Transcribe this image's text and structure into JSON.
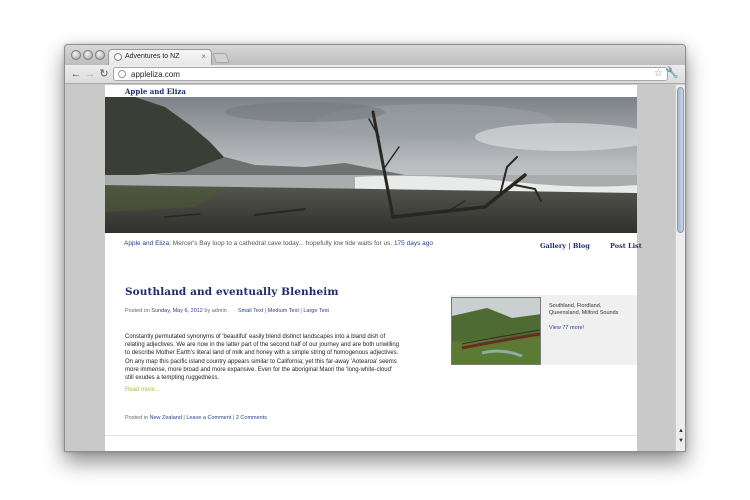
{
  "browser": {
    "tab_title": "Adventures to NZ",
    "url": "appleliza.com"
  },
  "site": {
    "title": "Apple and Eliza",
    "intro_author": "Apple and Eliza:",
    "intro_text": " Mercer's Bay loop to a cathedral cave today... hopefully low tide waits for us. ",
    "intro_time": "175 days ago",
    "nav_gallery": "Gallery | Blog",
    "nav_postlist": "Post List"
  },
  "post": {
    "title": "Southland and eventually Blenheim",
    "posted_on_label": "Posted on ",
    "date": "Sunday, May 6, 2012",
    "by_label": " by ",
    "author": "admin",
    "text_small": "Small Text",
    "text_medium": "Medium Text",
    "text_large": "Large Text",
    "body": "Constantly permutated synonyms of 'beautiful' easily blend distinct landscapes into a bland dish of relating adjectives. We are now in the latter part of the second half of our journey and are both unwilling to describe Mother Earth's literal land of milk and honey with a simple string of homogenous adjectives. On any map this pacific island country appears similar to California; yet this far-away 'Aotearoa' seems more immense, more broad and more expansive. Even for the aboriginal Maori the 'long-white-cloud' still exudes a tempting ruggedness.",
    "read_more": "Read more...",
    "posted_in_label": "Posted in ",
    "category": "New Zealand",
    "leave_comment": "Leave a Comment",
    "comments": "2 Comments"
  },
  "sidebar": {
    "gallery_caption": "Southland, Fiordland, Queensland, Milford Sounds",
    "view_more": "View 77 more!"
  },
  "colors": {
    "title_blue": "#1c2c6e",
    "link_blue": "#2a3f8f",
    "read_more_green": "#a8c13b"
  }
}
